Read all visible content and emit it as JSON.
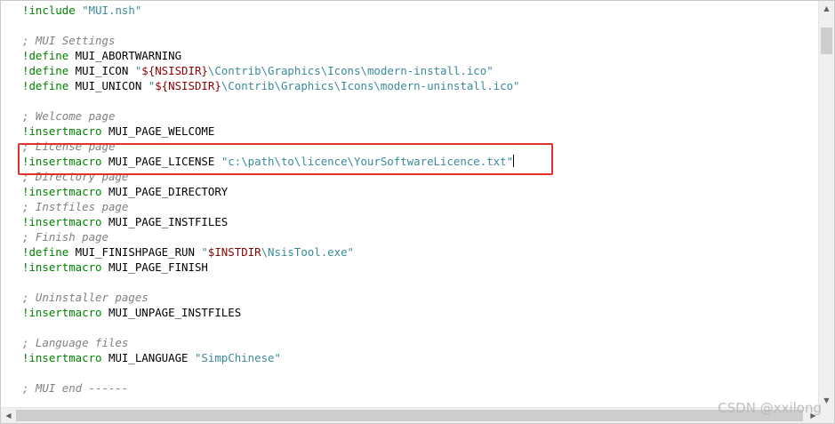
{
  "editor": {
    "lines": [
      {
        "segments": [
          {
            "cls": "directive",
            "text": "!include"
          },
          {
            "cls": "",
            "text": " "
          },
          {
            "cls": "string",
            "text": "\"MUI.nsh\""
          }
        ]
      },
      {
        "segments": []
      },
      {
        "segments": [
          {
            "cls": "comment",
            "text": "; MUI Settings"
          }
        ]
      },
      {
        "segments": [
          {
            "cls": "directive",
            "text": "!define"
          },
          {
            "cls": "",
            "text": " MUI_ABORTWARNING"
          }
        ]
      },
      {
        "segments": [
          {
            "cls": "directive",
            "text": "!define"
          },
          {
            "cls": "",
            "text": " MUI_ICON "
          },
          {
            "cls": "string",
            "text": "\""
          },
          {
            "cls": "variable",
            "text": "${NSISDIR}"
          },
          {
            "cls": "string",
            "text": "\\Contrib\\Graphics\\Icons\\modern-install.ico\""
          }
        ]
      },
      {
        "segments": [
          {
            "cls": "directive",
            "text": "!define"
          },
          {
            "cls": "",
            "text": " MUI_UNICON "
          },
          {
            "cls": "string",
            "text": "\""
          },
          {
            "cls": "variable",
            "text": "${NSISDIR}"
          },
          {
            "cls": "string",
            "text": "\\Contrib\\Graphics\\Icons\\modern-uninstall.ico\""
          }
        ]
      },
      {
        "segments": []
      },
      {
        "segments": [
          {
            "cls": "comment",
            "text": "; Welcome page"
          }
        ]
      },
      {
        "segments": [
          {
            "cls": "directive",
            "text": "!insertmacro"
          },
          {
            "cls": "",
            "text": " MUI_PAGE_WELCOME"
          }
        ]
      },
      {
        "segments": [
          {
            "cls": "comment",
            "text": "; License page"
          }
        ]
      },
      {
        "segments": [
          {
            "cls": "directive",
            "text": "!insertmacro"
          },
          {
            "cls": "",
            "text": " MUI_PAGE_LICENSE "
          },
          {
            "cls": "string",
            "text": "\"c:\\path\\to\\licence\\YourSoftwareLicence.txt\""
          }
        ],
        "caret": true
      },
      {
        "segments": [
          {
            "cls": "comment",
            "text": "; Directory page"
          }
        ]
      },
      {
        "segments": [
          {
            "cls": "directive",
            "text": "!insertmacro"
          },
          {
            "cls": "",
            "text": " MUI_PAGE_DIRECTORY"
          }
        ]
      },
      {
        "segments": [
          {
            "cls": "comment",
            "text": "; Instfiles page"
          }
        ]
      },
      {
        "segments": [
          {
            "cls": "directive",
            "text": "!insertmacro"
          },
          {
            "cls": "",
            "text": " MUI_PAGE_INSTFILES"
          }
        ]
      },
      {
        "segments": [
          {
            "cls": "comment",
            "text": "; Finish page"
          }
        ]
      },
      {
        "segments": [
          {
            "cls": "directive",
            "text": "!define"
          },
          {
            "cls": "",
            "text": " MUI_FINISHPAGE_RUN "
          },
          {
            "cls": "string",
            "text": "\""
          },
          {
            "cls": "variable",
            "text": "$INSTDIR"
          },
          {
            "cls": "string",
            "text": "\\NsisTool.exe\""
          }
        ]
      },
      {
        "segments": [
          {
            "cls": "directive",
            "text": "!insertmacro"
          },
          {
            "cls": "",
            "text": " MUI_PAGE_FINISH"
          }
        ]
      },
      {
        "segments": []
      },
      {
        "segments": [
          {
            "cls": "comment",
            "text": "; Uninstaller pages"
          }
        ]
      },
      {
        "segments": [
          {
            "cls": "directive",
            "text": "!insertmacro"
          },
          {
            "cls": "",
            "text": " MUI_UNPAGE_INSTFILES"
          }
        ]
      },
      {
        "segments": []
      },
      {
        "segments": [
          {
            "cls": "comment",
            "text": "; Language files"
          }
        ]
      },
      {
        "segments": [
          {
            "cls": "directive",
            "text": "!insertmacro"
          },
          {
            "cls": "",
            "text": " MUI_LANGUAGE "
          },
          {
            "cls": "string",
            "text": "\"SimpChinese\""
          }
        ]
      },
      {
        "segments": []
      },
      {
        "segments": [
          {
            "cls": "comment",
            "text": "; MUI end ------"
          }
        ]
      }
    ]
  },
  "scrollbars": {
    "up_icon": "chevron-up-icon",
    "down_icon": "chevron-down-icon",
    "left_icon": "chevron-left-icon",
    "right_icon": "chevron-right-icon"
  },
  "watermark": "CSDN @xxilong",
  "colors": {
    "directive": "#008000",
    "comment": "#808080",
    "string": "#3a8a9a",
    "variable": "#8b0000",
    "highlight": "#e3322b"
  }
}
